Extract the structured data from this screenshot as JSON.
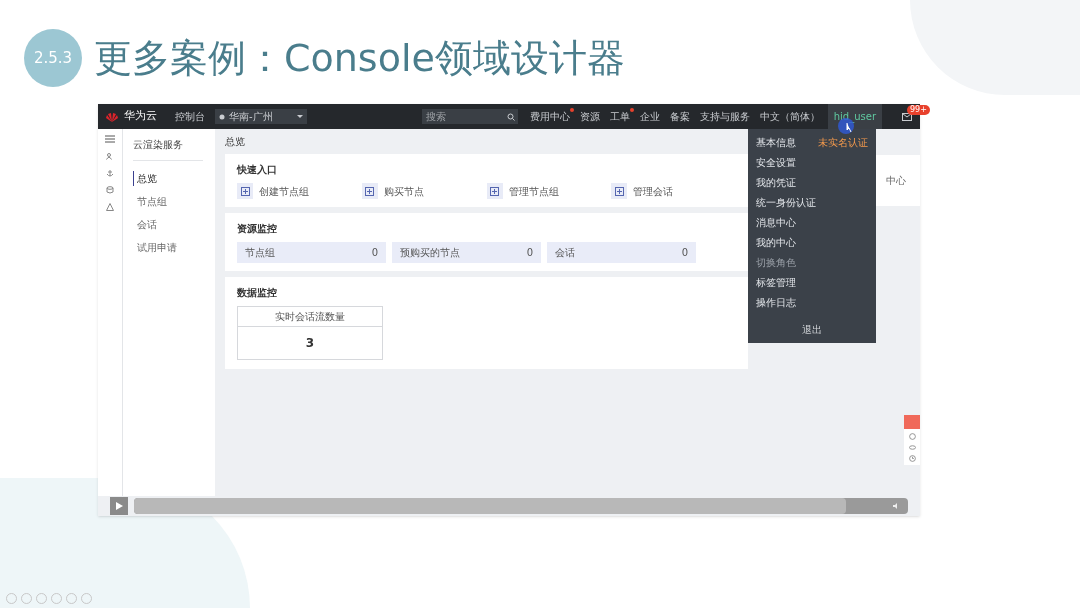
{
  "slide": {
    "section_number": "2.5.3",
    "title": "更多案例：Console领域设计器"
  },
  "console": {
    "top_bar": {
      "brand": "华为云",
      "console_link": "控制台",
      "region": "华南-广州",
      "search": {
        "placeholder": "搜索"
      },
      "nav": [
        {
          "label": "费用中心",
          "dot": true
        },
        {
          "label": "资源",
          "dot": false
        },
        {
          "label": "工单",
          "dot": true
        },
        {
          "label": "企业",
          "dot": false
        },
        {
          "label": "备案",
          "dot": false
        },
        {
          "label": "支持与服务",
          "dot": false
        },
        {
          "label": "中文（简体）",
          "dot": false
        }
      ],
      "user": "hid_user",
      "messages_badge": "99+"
    },
    "sidebar": {
      "title": "云渲染服务",
      "items": [
        {
          "label": "总览",
          "selected": true
        },
        {
          "label": "节点组",
          "selected": false
        },
        {
          "label": "会话",
          "selected": false
        },
        {
          "label": "试用申请",
          "selected": false
        }
      ]
    },
    "page_title": "总览",
    "quick_entry": {
      "title": "快速入口",
      "items": [
        "创建节点组",
        "购买节点",
        "管理节点组",
        "管理会话"
      ]
    },
    "resource_monitor": {
      "title": "资源监控",
      "items": [
        {
          "label": "节点组",
          "value": "0"
        },
        {
          "label": "预购买的节点",
          "value": "0"
        },
        {
          "label": "会话",
          "value": "0"
        }
      ]
    },
    "data_monitor": {
      "title": "数据监控",
      "cards": [
        {
          "label": "实时会话流数量",
          "value": "3"
        }
      ]
    },
    "side_card": {
      "text": "中心"
    },
    "user_menu": {
      "items": [
        {
          "label": "基本信息",
          "disabled": false,
          "badge": "未实名认证"
        },
        {
          "label": "安全设置",
          "disabled": false
        },
        {
          "label": "我的凭证",
          "disabled": false
        },
        {
          "label": "统一身份认证",
          "disabled": false
        },
        {
          "label": "消息中心",
          "disabled": false
        },
        {
          "label": "我的中心",
          "disabled": false
        },
        {
          "label": "切换角色",
          "disabled": true
        },
        {
          "label": "标签管理",
          "disabled": false
        },
        {
          "label": "操作日志",
          "disabled": false
        }
      ],
      "logout": "退出"
    },
    "video_player": {
      "level": 0.92
    }
  }
}
